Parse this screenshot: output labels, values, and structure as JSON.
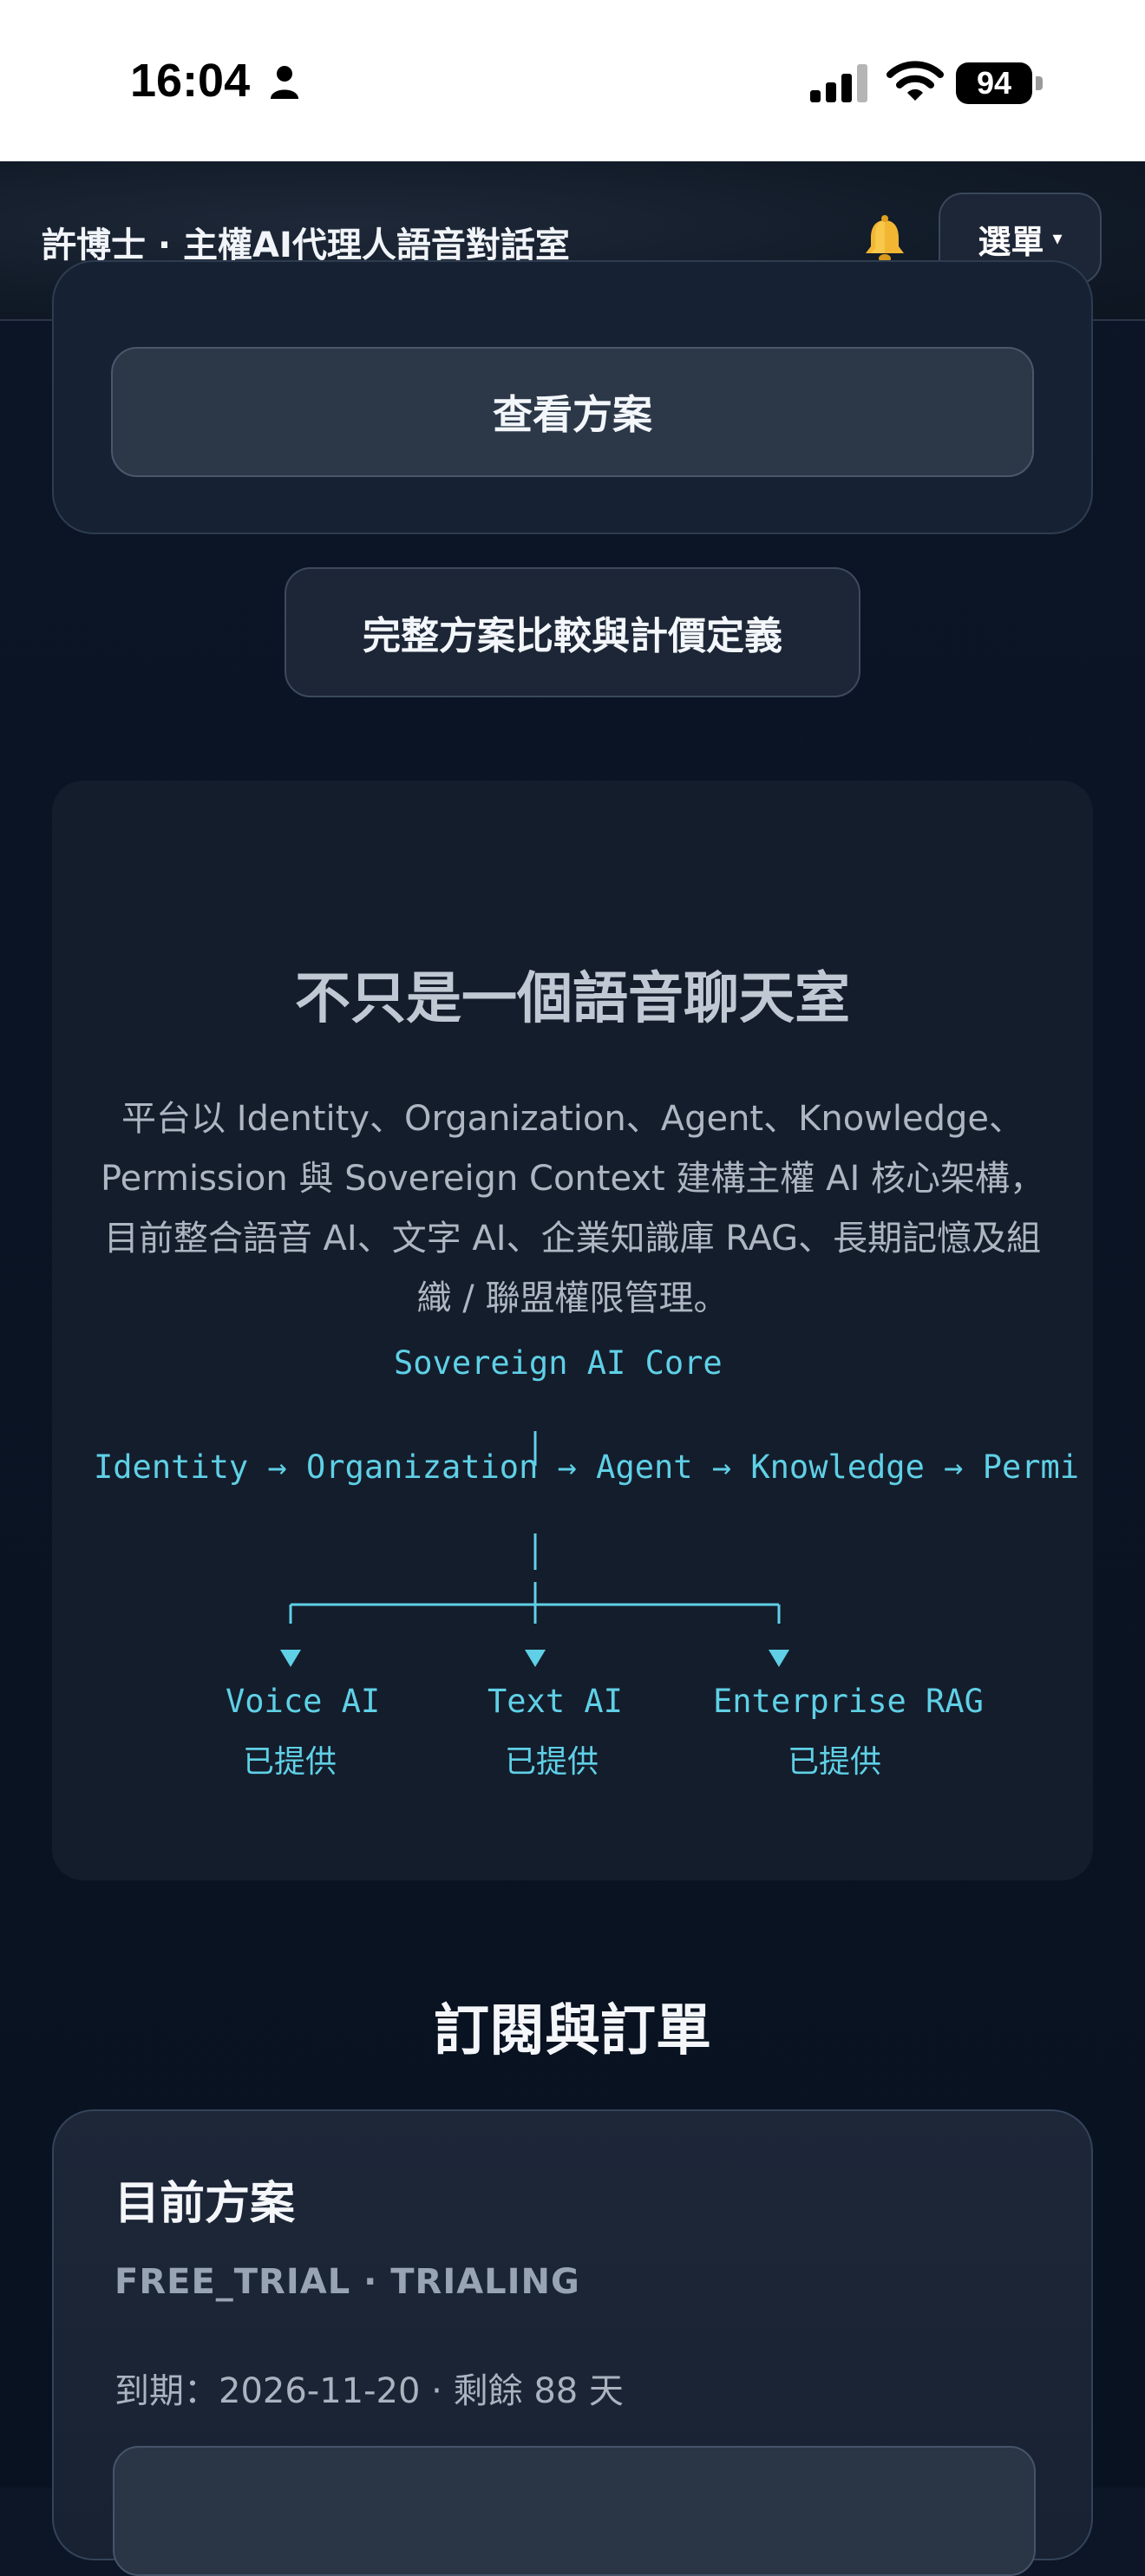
{
  "status_bar": {
    "time": "16:04",
    "battery": "94",
    "icons": [
      "person-icon",
      "signal-icon",
      "wifi-icon",
      "battery-icon"
    ]
  },
  "header": {
    "title": "許博士 · 主權AI代理人語音對話室",
    "notification_icon": "bell-icon",
    "menu_label": "選單",
    "menu_caret": "▾"
  },
  "plans_section": {
    "view_plan_label": "查看方案",
    "compare_label": "完整方案比較與計價定義"
  },
  "core_section": {
    "heading": "不只是一個語音聊天室",
    "description": "平台以 Identity、Organization、Agent、Knowledge、Permission 與 Sovereign Context 建構主權 AI 核心架構，目前整合語音 AI、文字 AI、企業知識庫 RAG、長期記憶及組織 / 聯盟權限管理。",
    "diagram": {
      "root": "Sovereign AI Core",
      "pipeline": "Identity → Organization → Agent → Knowledge → Permi",
      "branches": [
        {
          "name": "Voice AI",
          "status": "已提供"
        },
        {
          "name": "Text AI",
          "status": "已提供"
        },
        {
          "name": "Enterprise RAG",
          "status": "已提供"
        }
      ]
    }
  },
  "subscription": {
    "title": "訂閱與訂單",
    "current_plan_label": "目前方案",
    "plan_status": "FREE_TRIAL · TRIALING",
    "expiry": "到期：2026-11-20 · 剩餘 88 天"
  },
  "colors": {
    "accent_cyan": "#5fd0e6",
    "background": "#0a1424",
    "card": "#141d2c"
  }
}
